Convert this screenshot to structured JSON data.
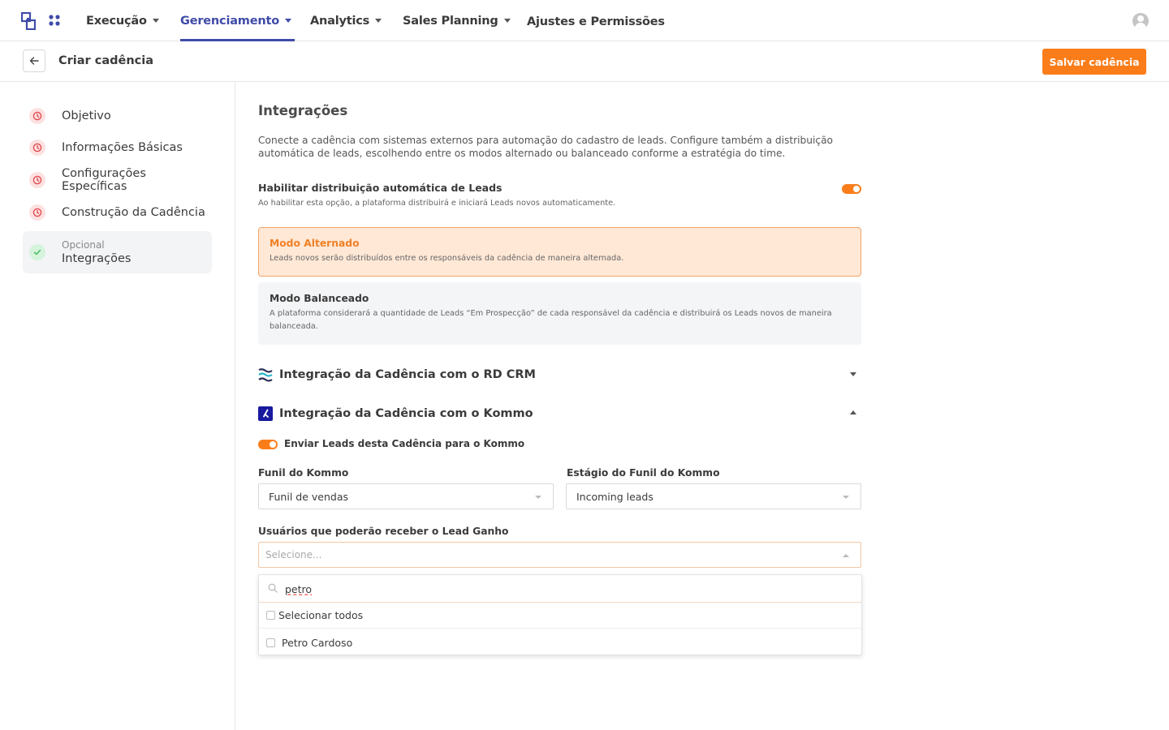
{
  "nav": {
    "items": [
      {
        "label": "Execução"
      },
      {
        "label": "Gerenciamento"
      },
      {
        "label": "Analytics"
      },
      {
        "label": "Sales Planning"
      },
      {
        "label": "Ajustes e Permissões"
      }
    ],
    "active": "Gerenciamento"
  },
  "header": {
    "title": "Criar cadência",
    "save_label": "Salvar cadência"
  },
  "sidebar": {
    "steps": [
      {
        "label": "Objetivo",
        "status": "pending"
      },
      {
        "label": "Informações Básicas",
        "status": "pending"
      },
      {
        "label": "Configurações Específicas",
        "status": "pending"
      },
      {
        "label": "Construção da Cadência",
        "status": "pending"
      },
      {
        "sublabel": "Opcional",
        "label": "Integrações",
        "status": "done"
      }
    ]
  },
  "main": {
    "title": "Integrações",
    "description": "Conecte a cadência com sistemas externos para automação do cadastro de leads. Configure também a distribuição automática de leads, escolhendo entre os modos alternado ou balanceado conforme a estratégia do time.",
    "auto_distribution": {
      "title": "Habilitar distribuição automática de Leads",
      "description": "Ao habilitar esta opção, a plataforma distribuirá e iniciará Leads novos automaticamente.",
      "enabled": true
    },
    "modes": [
      {
        "title": "Modo Alternado",
        "description": "Leads novos serão distribuídos entre os responsáveis da cadência de maneira alternada.",
        "selected": true
      },
      {
        "title": "Modo Balanceado",
        "description": "A plataforma considerará a quantidade de Leads “Em Prospecção” de cada responsável da cadência e distribuirá os Leads novos de maneira balanceada.",
        "selected": false
      }
    ],
    "integrations": [
      {
        "title": "Integração da Cadência com o RD CRM",
        "expanded": false
      },
      {
        "title": "Integração da Cadência com o Kommo",
        "expanded": true
      }
    ],
    "kommo": {
      "send_toggle_label": "Enviar Leads desta Cadência para o Kommo",
      "send_enabled": true,
      "funnel_label": "Funil do Kommo",
      "funnel_value": "Funil de vendas",
      "stage_label": "Estágio do Funil do Kommo",
      "stage_value": "Incoming leads",
      "users_label": "Usuários que poderão receber o Lead Ganho",
      "users_placeholder": "Selecione...",
      "search_value": "petro",
      "select_all_label": "Selecionar todos",
      "options": [
        "Petro Cardoso"
      ]
    }
  },
  "colors": {
    "accent": "#fa7d1a",
    "nav_active": "#3f4ba8",
    "pending_step": "#e0474c",
    "done_step": "#3fba5c"
  }
}
